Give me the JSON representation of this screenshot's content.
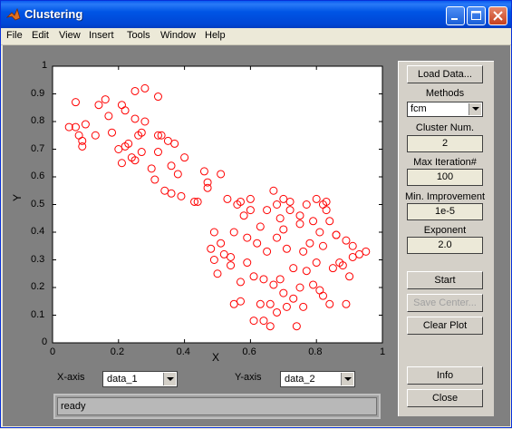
{
  "window": {
    "title": "Clustering"
  },
  "menu": [
    "File",
    "Edit",
    "View",
    "Insert",
    "Tools",
    "Window",
    "Help"
  ],
  "plot": {
    "xlabel": "X",
    "ylabel": "Y",
    "x_ticks": [
      "0",
      "0.2",
      "0.4",
      "0.6",
      "0.8",
      "1"
    ],
    "y_ticks": [
      "0",
      "0.1",
      "0.2",
      "0.3",
      "0.4",
      "0.5",
      "0.6",
      "0.7",
      "0.8",
      "0.9",
      "1"
    ],
    "marker_color": "#ff0000",
    "points": [
      [
        0.05,
        0.78
      ],
      [
        0.07,
        0.78
      ],
      [
        0.07,
        0.87
      ],
      [
        0.08,
        0.75
      ],
      [
        0.09,
        0.73
      ],
      [
        0.09,
        0.71
      ],
      [
        0.1,
        0.79
      ],
      [
        0.13,
        0.75
      ],
      [
        0.14,
        0.86
      ],
      [
        0.16,
        0.88
      ],
      [
        0.17,
        0.82
      ],
      [
        0.18,
        0.76
      ],
      [
        0.2,
        0.7
      ],
      [
        0.21,
        0.86
      ],
      [
        0.21,
        0.65
      ],
      [
        0.22,
        0.84
      ],
      [
        0.22,
        0.71
      ],
      [
        0.23,
        0.72
      ],
      [
        0.24,
        0.67
      ],
      [
        0.25,
        0.91
      ],
      [
        0.25,
        0.81
      ],
      [
        0.25,
        0.66
      ],
      [
        0.26,
        0.75
      ],
      [
        0.27,
        0.69
      ],
      [
        0.27,
        0.76
      ],
      [
        0.28,
        0.92
      ],
      [
        0.28,
        0.8
      ],
      [
        0.3,
        0.63
      ],
      [
        0.31,
        0.59
      ],
      [
        0.32,
        0.69
      ],
      [
        0.32,
        0.75
      ],
      [
        0.32,
        0.89
      ],
      [
        0.33,
        0.75
      ],
      [
        0.34,
        0.55
      ],
      [
        0.35,
        0.73
      ],
      [
        0.36,
        0.64
      ],
      [
        0.36,
        0.54
      ],
      [
        0.37,
        0.72
      ],
      [
        0.38,
        0.61
      ],
      [
        0.39,
        0.53
      ],
      [
        0.4,
        0.67
      ],
      [
        0.43,
        0.51
      ],
      [
        0.44,
        0.51
      ],
      [
        0.46,
        0.62
      ],
      [
        0.47,
        0.58
      ],
      [
        0.47,
        0.56
      ],
      [
        0.48,
        0.34
      ],
      [
        0.49,
        0.3
      ],
      [
        0.49,
        0.4
      ],
      [
        0.5,
        0.25
      ],
      [
        0.51,
        0.61
      ],
      [
        0.51,
        0.36
      ],
      [
        0.52,
        0.32
      ],
      [
        0.53,
        0.52
      ],
      [
        0.54,
        0.31
      ],
      [
        0.54,
        0.28
      ],
      [
        0.55,
        0.4
      ],
      [
        0.55,
        0.14
      ],
      [
        0.56,
        0.5
      ],
      [
        0.57,
        0.22
      ],
      [
        0.57,
        0.15
      ],
      [
        0.58,
        0.46
      ],
      [
        0.59,
        0.38
      ],
      [
        0.59,
        0.29
      ],
      [
        0.6,
        0.52
      ],
      [
        0.6,
        0.48
      ],
      [
        0.61,
        0.24
      ],
      [
        0.61,
        0.08
      ],
      [
        0.62,
        0.36
      ],
      [
        0.63,
        0.42
      ],
      [
        0.63,
        0.14
      ],
      [
        0.64,
        0.23
      ],
      [
        0.64,
        0.08
      ],
      [
        0.65,
        0.48
      ],
      [
        0.65,
        0.33
      ],
      [
        0.66,
        0.14
      ],
      [
        0.66,
        0.06
      ],
      [
        0.67,
        0.55
      ],
      [
        0.67,
        0.21
      ],
      [
        0.68,
        0.5
      ],
      [
        0.68,
        0.38
      ],
      [
        0.69,
        0.45
      ],
      [
        0.69,
        0.23
      ],
      [
        0.7,
        0.52
      ],
      [
        0.7,
        0.41
      ],
      [
        0.7,
        0.18
      ],
      [
        0.71,
        0.34
      ],
      [
        0.71,
        0.13
      ],
      [
        0.72,
        0.51
      ],
      [
        0.72,
        0.48
      ],
      [
        0.73,
        0.27
      ],
      [
        0.73,
        0.16
      ],
      [
        0.74,
        0.06
      ],
      [
        0.75,
        0.46
      ],
      [
        0.75,
        0.43
      ],
      [
        0.76,
        0.33
      ],
      [
        0.76,
        0.13
      ],
      [
        0.77,
        0.5
      ],
      [
        0.77,
        0.26
      ],
      [
        0.78,
        0.36
      ],
      [
        0.79,
        0.44
      ],
      [
        0.79,
        0.21
      ],
      [
        0.8,
        0.52
      ],
      [
        0.8,
        0.29
      ],
      [
        0.81,
        0.4
      ],
      [
        0.81,
        0.19
      ],
      [
        0.82,
        0.5
      ],
      [
        0.82,
        0.35
      ],
      [
        0.83,
        0.51
      ],
      [
        0.83,
        0.48
      ],
      [
        0.84,
        0.44
      ],
      [
        0.84,
        0.14
      ],
      [
        0.85,
        0.27
      ],
      [
        0.86,
        0.39
      ],
      [
        0.87,
        0.29
      ],
      [
        0.88,
        0.28
      ],
      [
        0.89,
        0.37
      ],
      [
        0.89,
        0.14
      ],
      [
        0.9,
        0.24
      ],
      [
        0.91,
        0.35
      ],
      [
        0.91,
        0.31
      ],
      [
        0.93,
        0.32
      ],
      [
        0.95,
        0.33
      ],
      [
        0.68,
        0.11
      ],
      [
        0.75,
        0.2
      ],
      [
        0.86,
        0.39
      ],
      [
        0.82,
        0.17
      ],
      [
        0.57,
        0.51
      ]
    ]
  },
  "axes_select": {
    "x_label": "X-axis",
    "x_value": "data_1",
    "y_label": "Y-axis",
    "y_value": "data_2"
  },
  "status": "ready",
  "panel": {
    "load_button": "Load Data...",
    "methods_label": "Methods",
    "method_value": "fcm",
    "cluster_label": "Cluster Num.",
    "cluster_value": "2",
    "maxiter_label": "Max Iteration#",
    "maxiter_value": "100",
    "minimp_label": "Min. Improvement",
    "minimp_value": "1e-5",
    "exponent_label": "Exponent",
    "exponent_value": "2.0",
    "start_button": "Start",
    "save_button": "Save Center...",
    "clear_button": "Clear Plot",
    "info_button": "Info",
    "close_button": "Close"
  }
}
